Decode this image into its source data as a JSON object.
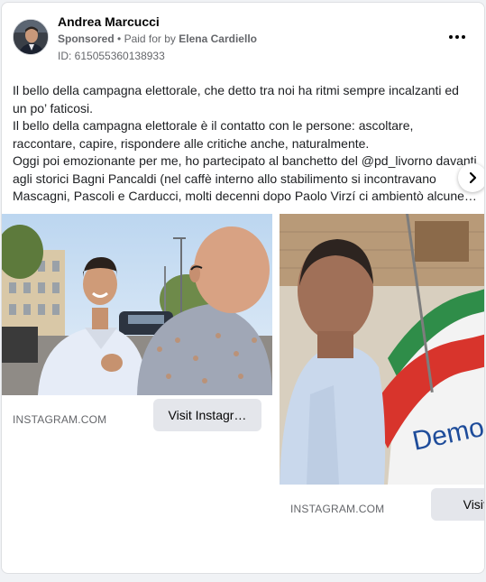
{
  "post": {
    "author": "Andrea Marcucci",
    "sponsored_label": "Sponsored",
    "paid_for_prefix": "Paid for by",
    "paid_for_name": "Elena Cardiello",
    "id_text": "ID: 615055360138933",
    "body_lines": [
      "Il bello della campagna elettorale, che detto tra noi ha ritmi sempre incalzanti ed",
      "un po’ faticosi.",
      "Il bello della campagna elettorale è il contatto con le persone: ascoltare,",
      "raccontare, capire, rispondere alle critiche anche, naturalmente.",
      "Oggi poi emozionante per me, ho partecipato al banchetto del @pd_livorno davanti",
      "agli storici Bagni Pancaldi (nel caffè interno allo stabilimento si incontravano",
      "Mascagni, Pascoli e Carducci, molti decenni dopo Paolo Virzí ci ambientò alcune…"
    ]
  },
  "carousel": {
    "cards": [
      {
        "domain": "INSTAGRAM.COM",
        "button_label": "Visit Instagr…"
      },
      {
        "domain": "INSTAGRAM.COM",
        "button_label": "Visit Ins"
      }
    ],
    "flag_text": "Democ"
  },
  "colors": {
    "secondary_text": "#65676b",
    "button_bg": "#e4e6eb",
    "card_border": "#dddfe2"
  },
  "icons": {
    "more": "more-horizontal-icon",
    "next": "chevron-right-icon"
  }
}
